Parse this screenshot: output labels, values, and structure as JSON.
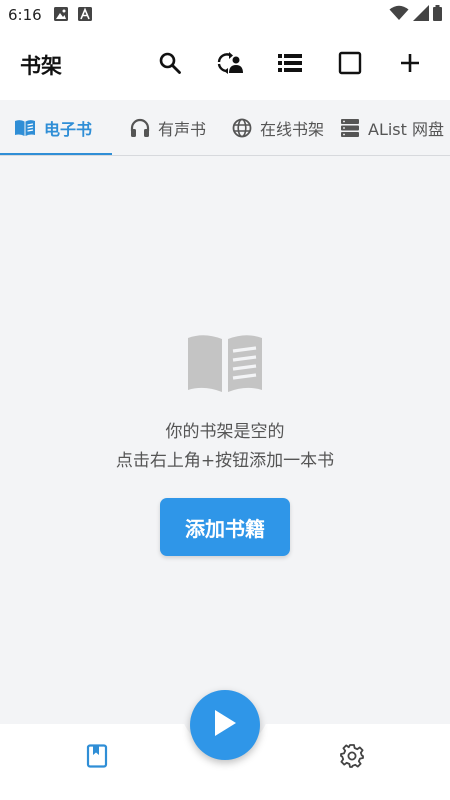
{
  "status_bar": {
    "time": "6:16",
    "icons": [
      "image-icon",
      "a-icon",
      "wifi-icon",
      "signal-icon",
      "battery-icon"
    ]
  },
  "app_bar": {
    "title": "书架",
    "actions": [
      "search-icon",
      "sync-icon",
      "list-view-icon",
      "select-icon",
      "add-icon"
    ]
  },
  "tabs": [
    {
      "label": "电子书",
      "icon": "book-icon",
      "active": true
    },
    {
      "label": "有声书",
      "icon": "headphones-icon",
      "active": false
    },
    {
      "label": "在线书架",
      "icon": "globe-icon",
      "active": false
    },
    {
      "label": "AList 网盘",
      "icon": "server-icon",
      "active": false
    }
  ],
  "empty_state": {
    "icon": "open-book-icon",
    "line1": "你的书架是空的",
    "line2": "点击右上角+按钮添加一本书",
    "button_label": "添加书籍"
  },
  "bottom_nav": {
    "items": [
      "bookshelf-icon",
      "play-icon",
      "settings-icon"
    ],
    "active": "bookshelf-icon"
  },
  "colors": {
    "accent": "#2f96e8",
    "tab_active": "#2f8ed6",
    "background": "#f3f4f6",
    "surface": "#ffffff"
  }
}
